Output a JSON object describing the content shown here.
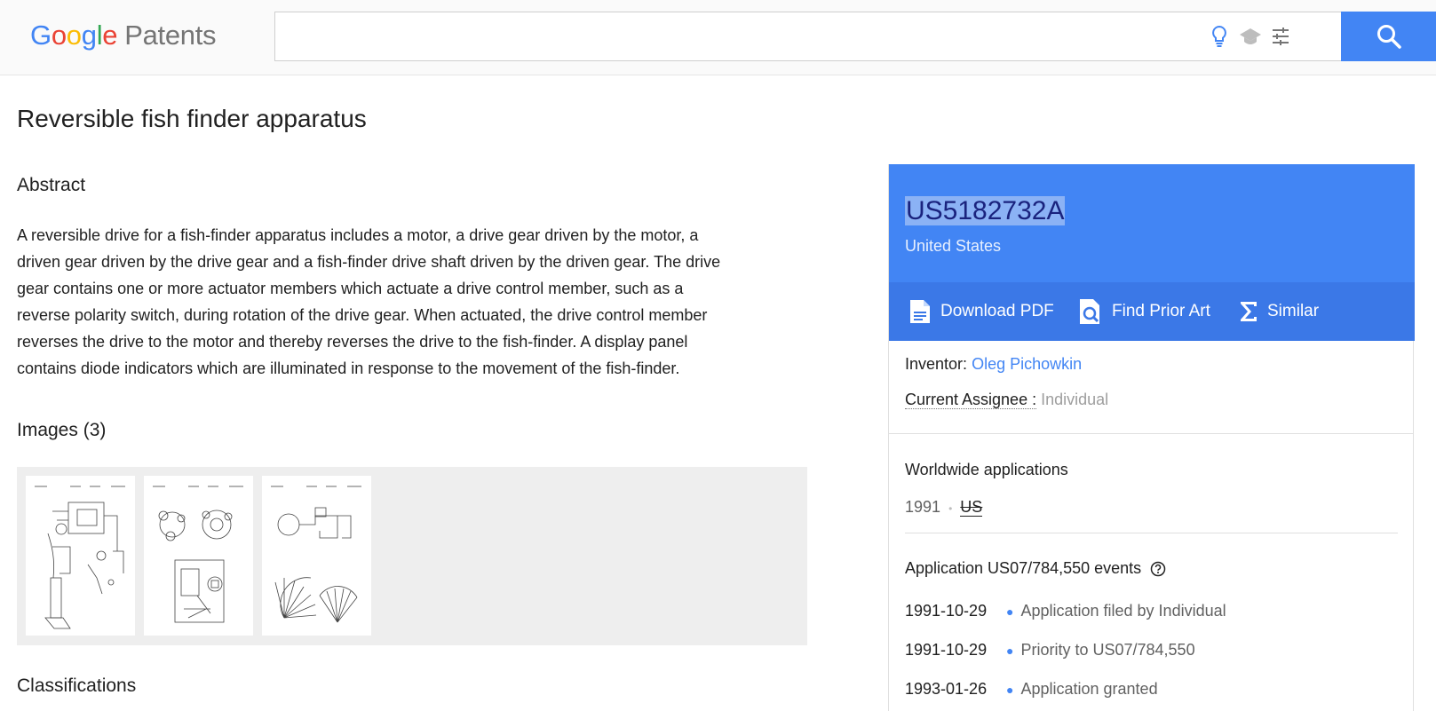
{
  "header": {
    "logo_letters": [
      "G",
      "o",
      "o",
      "g",
      "l",
      "e"
    ],
    "logo_product": "Patents",
    "search_value": "",
    "search_placeholder": ""
  },
  "title": "Reversible fish finder apparatus",
  "abstract": {
    "heading": "Abstract",
    "lines": [
      "A reversible drive for a fish-finder apparatus includes a motor, a drive gear driven by the motor, a",
      "driven gear driven by the drive gear and a fish-finder drive shaft driven by the driven gear. The drive",
      "gear contains one or more actuator members which actuate a drive control member, such as a",
      "reverse polarity switch, during rotation of the drive gear. When actuated, the drive control member",
      "reverses the drive to the motor and thereby reverses the drive to the fish-finder. A display panel",
      "contains diode indicators which are illuminated in response to the movement of the fish-finder."
    ]
  },
  "images": {
    "heading": "Images (3)",
    "count": 3
  },
  "classifications": {
    "heading": "Classifications"
  },
  "panel": {
    "publication_number": "US5182732A",
    "country": "United States",
    "actions": {
      "download_pdf": "Download PDF",
      "find_prior_art": "Find Prior Art",
      "similar": "Similar"
    },
    "inventor_label": "Inventor:",
    "inventor_name": "Oleg Pichowkin",
    "assignee_label": "Current Assignee :",
    "assignee_value": "Individual",
    "worldwide_heading": "Worldwide applications",
    "worldwide_year": "1991",
    "worldwide_sep": "•",
    "worldwide_country": "US",
    "events_heading": "Application US07/784,550 events",
    "events": [
      {
        "date": "1991-10-29",
        "text": "Application filed by Individual"
      },
      {
        "date": "1991-10-29",
        "text": "Priority to US07/784,550"
      },
      {
        "date": "1993-01-26",
        "text": "Application granted"
      }
    ]
  },
  "colors": {
    "accent": "#4285f4",
    "accent_dark": "#3b78e7"
  }
}
